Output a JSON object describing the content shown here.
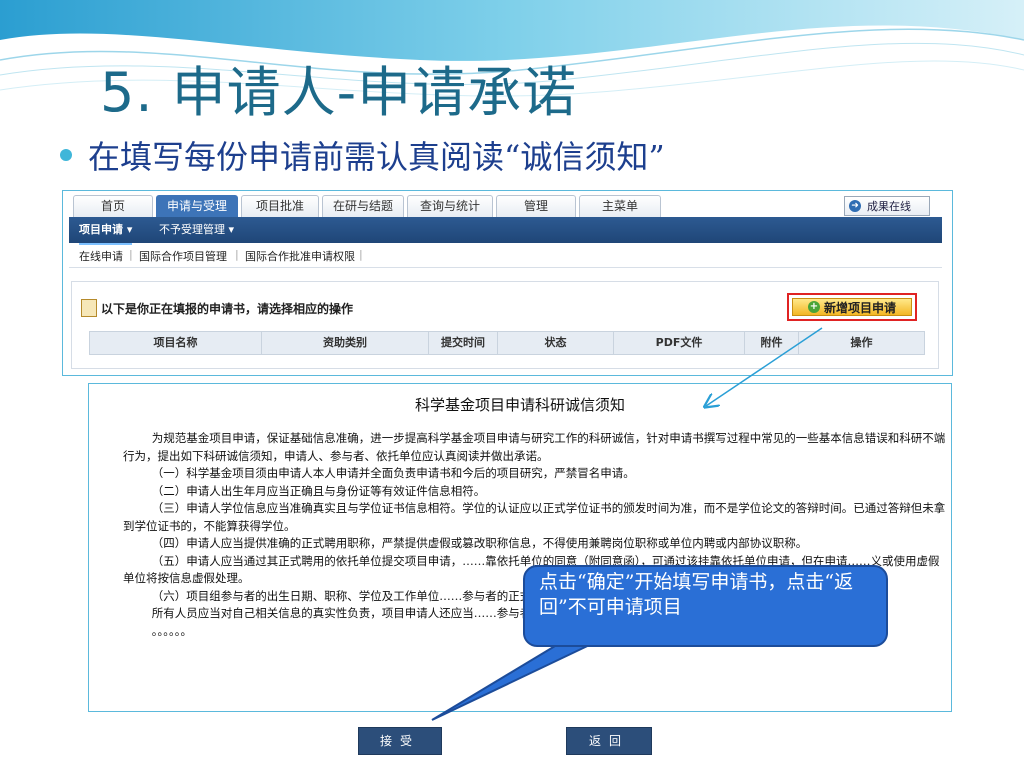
{
  "slide": {
    "title": "5. 申请人-申请承诺",
    "bullet": "在填写每份申请前需认真阅读“诚信须知”"
  },
  "app": {
    "tabs": [
      "首页",
      "申请与受理",
      "项目批准",
      "在研与结题",
      "查询与统计",
      "管理",
      "主菜单"
    ],
    "active_tab": "申请与受理",
    "result_button": "成果在线",
    "nav": [
      "项目申请",
      "不予受理管理"
    ],
    "subnav": [
      "在线申请",
      "国际合作项目管理",
      "国际合作批准申请权限"
    ],
    "hint": "以下是你正在填报的申请书，请选择相应的操作",
    "new_button": "新增项目申请",
    "table_headers": [
      "项目名称",
      "资助类别",
      "提交时间",
      "状态",
      "PDF文件",
      "附件",
      "操作"
    ]
  },
  "notice": {
    "title": "科学基金项目申请科研诚信须知",
    "paragraphs": [
      "为规范基金项目申请，保证基础信息准确，进一步提高科学基金项目申请与研究工作的科研诚信，针对申请书撰写过程中常见的一些基本信息错误和科研不端行为，提出如下科研诚信须知，申请人、参与者、依托单位应认真阅读并做出承诺。",
      "（一）科学基金项目须由申请人本人申请并全面负责申请书和今后的项目研究，严禁冒名申请。",
      "（二）申请人出生年月应当正确且与身份证等有效证件信息相符。",
      "（三）申请人学位信息应当准确真实且与学位证书信息相符。学位的认证应以正式学位证书的颁发时间为准，而不是学位论文的答辩时间。已通过答辩但未拿到学位证书的，不能算获得学位。",
      "（四）申请人应当提供准确的正式聘用职称，严禁提供虚假或篡改职称信息，不得使用兼聘岗位职称或单位内聘或内部协议职称。",
      "（五）申请人应当通过其正式聘用的依托单位提交项目申请，……靠依托单位的同意（附同意函），可通过该挂靠依托单位申请，但在申请……义或使用虚假单位将按信息虚假处理。",
      "（六）项目组参与者的出生日期、职称、学位及工作单位……参与者的正式聘用单位。严禁编造或提供虚假的参与者。",
      "所有人员应当对自己相关信息的真实性负责，项目申请人还应当……参与者的信息真实性负责，如出现问题，负有与参与者同等责任。",
      "。。。。。。"
    ]
  },
  "callout": {
    "text": "点击“确定”开始填写申请书，点击“返回”不可申请项目"
  },
  "buttons": {
    "accept": "接受",
    "back": "返回"
  },
  "colors": {
    "title": "#1d6a8a",
    "bullet_text": "#1d3f8e",
    "nav_bar": "#1f4677",
    "callout": "#2a6fd6",
    "highlight_border": "#e02323"
  }
}
